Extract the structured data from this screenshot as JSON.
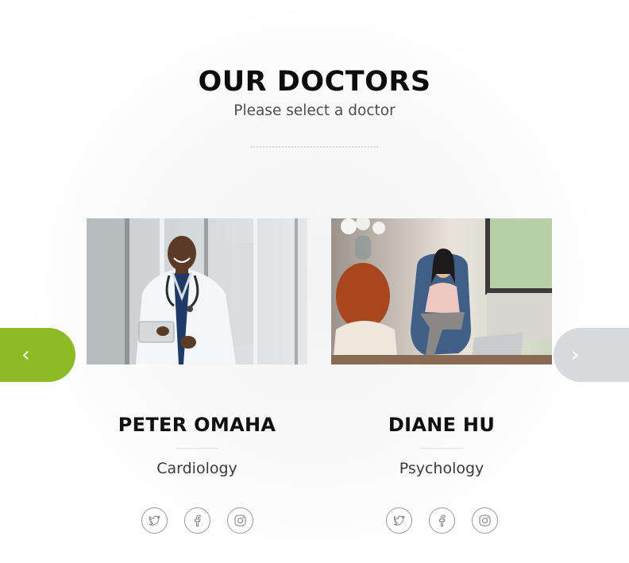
{
  "section": {
    "title": "OUR DOCTORS",
    "subtitle": "Please select a doctor"
  },
  "carousel": {
    "prev_icon": "chevron-left-icon",
    "next_icon": "chevron-right-icon",
    "prev_glyph": "‹",
    "next_glyph": "›",
    "colors": {
      "prev_bg": "#8cbb23",
      "next_bg": "#d9dadd"
    }
  },
  "doctors": [
    {
      "name": "PETER OMAHA",
      "specialty": "Cardiology",
      "social": [
        "twitter-icon",
        "facebook-icon",
        "instagram-icon"
      ]
    },
    {
      "name": "DIANE HU",
      "specialty": "Psychology",
      "social": [
        "twitter-icon",
        "facebook-icon",
        "instagram-icon"
      ]
    }
  ]
}
